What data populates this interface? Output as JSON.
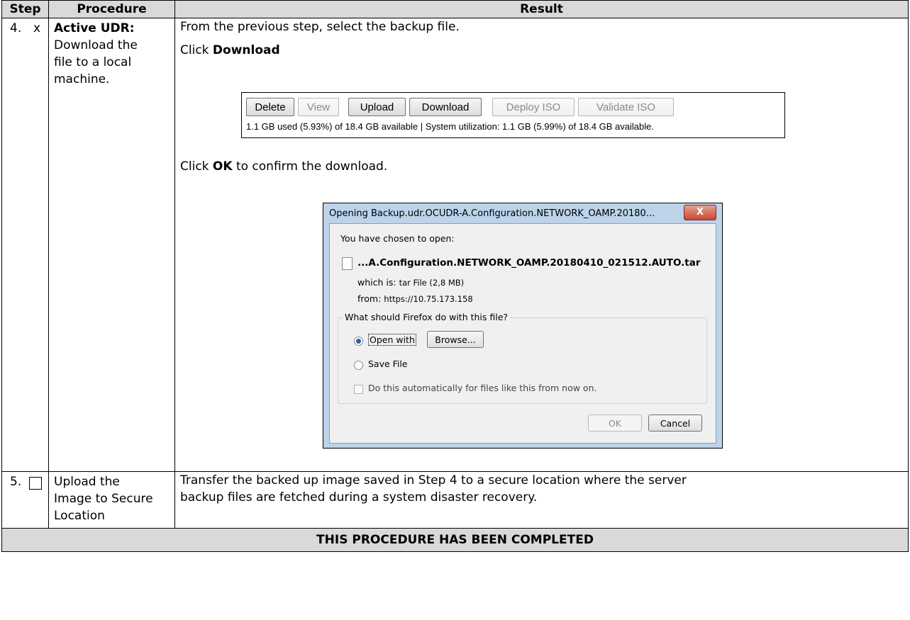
{
  "table": {
    "headers": [
      "Step",
      "Procedure",
      "Result"
    ],
    "rows": [
      {
        "step_number": "4.",
        "step_mark": "x",
        "procedure_bold": "Active UDR:",
        "procedure_lines": [
          "Download the",
          "file to a local",
          "machine."
        ],
        "result": {
          "line1": "From the previous step, select the backup file.",
          "line2_prefix": "Click ",
          "line2_bold": "Download",
          "line3_prefix": "Click ",
          "line3_bold": "OK",
          "line3_suffix": " to confirm the download."
        }
      },
      {
        "step_number": "5.",
        "procedure_lines": [
          "Upload the",
          "Image to Secure",
          "Location"
        ],
        "result_lines": [
          "Transfer the backed up image saved in Step 4 to a secure location where the server",
          "backup files are fetched during a system disaster recovery."
        ]
      }
    ],
    "footer": "THIS PROCEDURE HAS BEEN COMPLETED"
  },
  "toolbar": {
    "buttons": [
      {
        "label": "Delete",
        "enabled": true
      },
      {
        "label": "View",
        "enabled": false
      },
      {
        "label": "Upload",
        "enabled": true
      },
      {
        "label": "Download",
        "enabled": true
      },
      {
        "label": "Deploy ISO",
        "enabled": false
      },
      {
        "label": "Validate ISO",
        "enabled": false
      }
    ],
    "status": "1.1 GB used (5.93%) of 18.4 GB available | System utilization: 1.1 GB (5.99%) of 18.4 GB available."
  },
  "dialog": {
    "title": "Opening Backup.udr.OCUDR-A.Configuration.NETWORK_OAMP.20180...",
    "close_label": "X",
    "intro": "You have chosen to open:",
    "filename": "...A.Configuration.NETWORK_OAMP.20180410_021512.AUTO.tar",
    "which_label": "which is:",
    "which_value": "tar File (2,8 MB)",
    "from_label": "from:",
    "from_value": "https://10.75.173.158",
    "group_title": "What should Firefox do with this file?",
    "open_with_label": "Open with",
    "browse_label": "Browse...",
    "save_file_label": "Save File",
    "auto_label": "Do this automatically for files like this from now on.",
    "ok_label": "OK",
    "cancel_label": "Cancel"
  }
}
